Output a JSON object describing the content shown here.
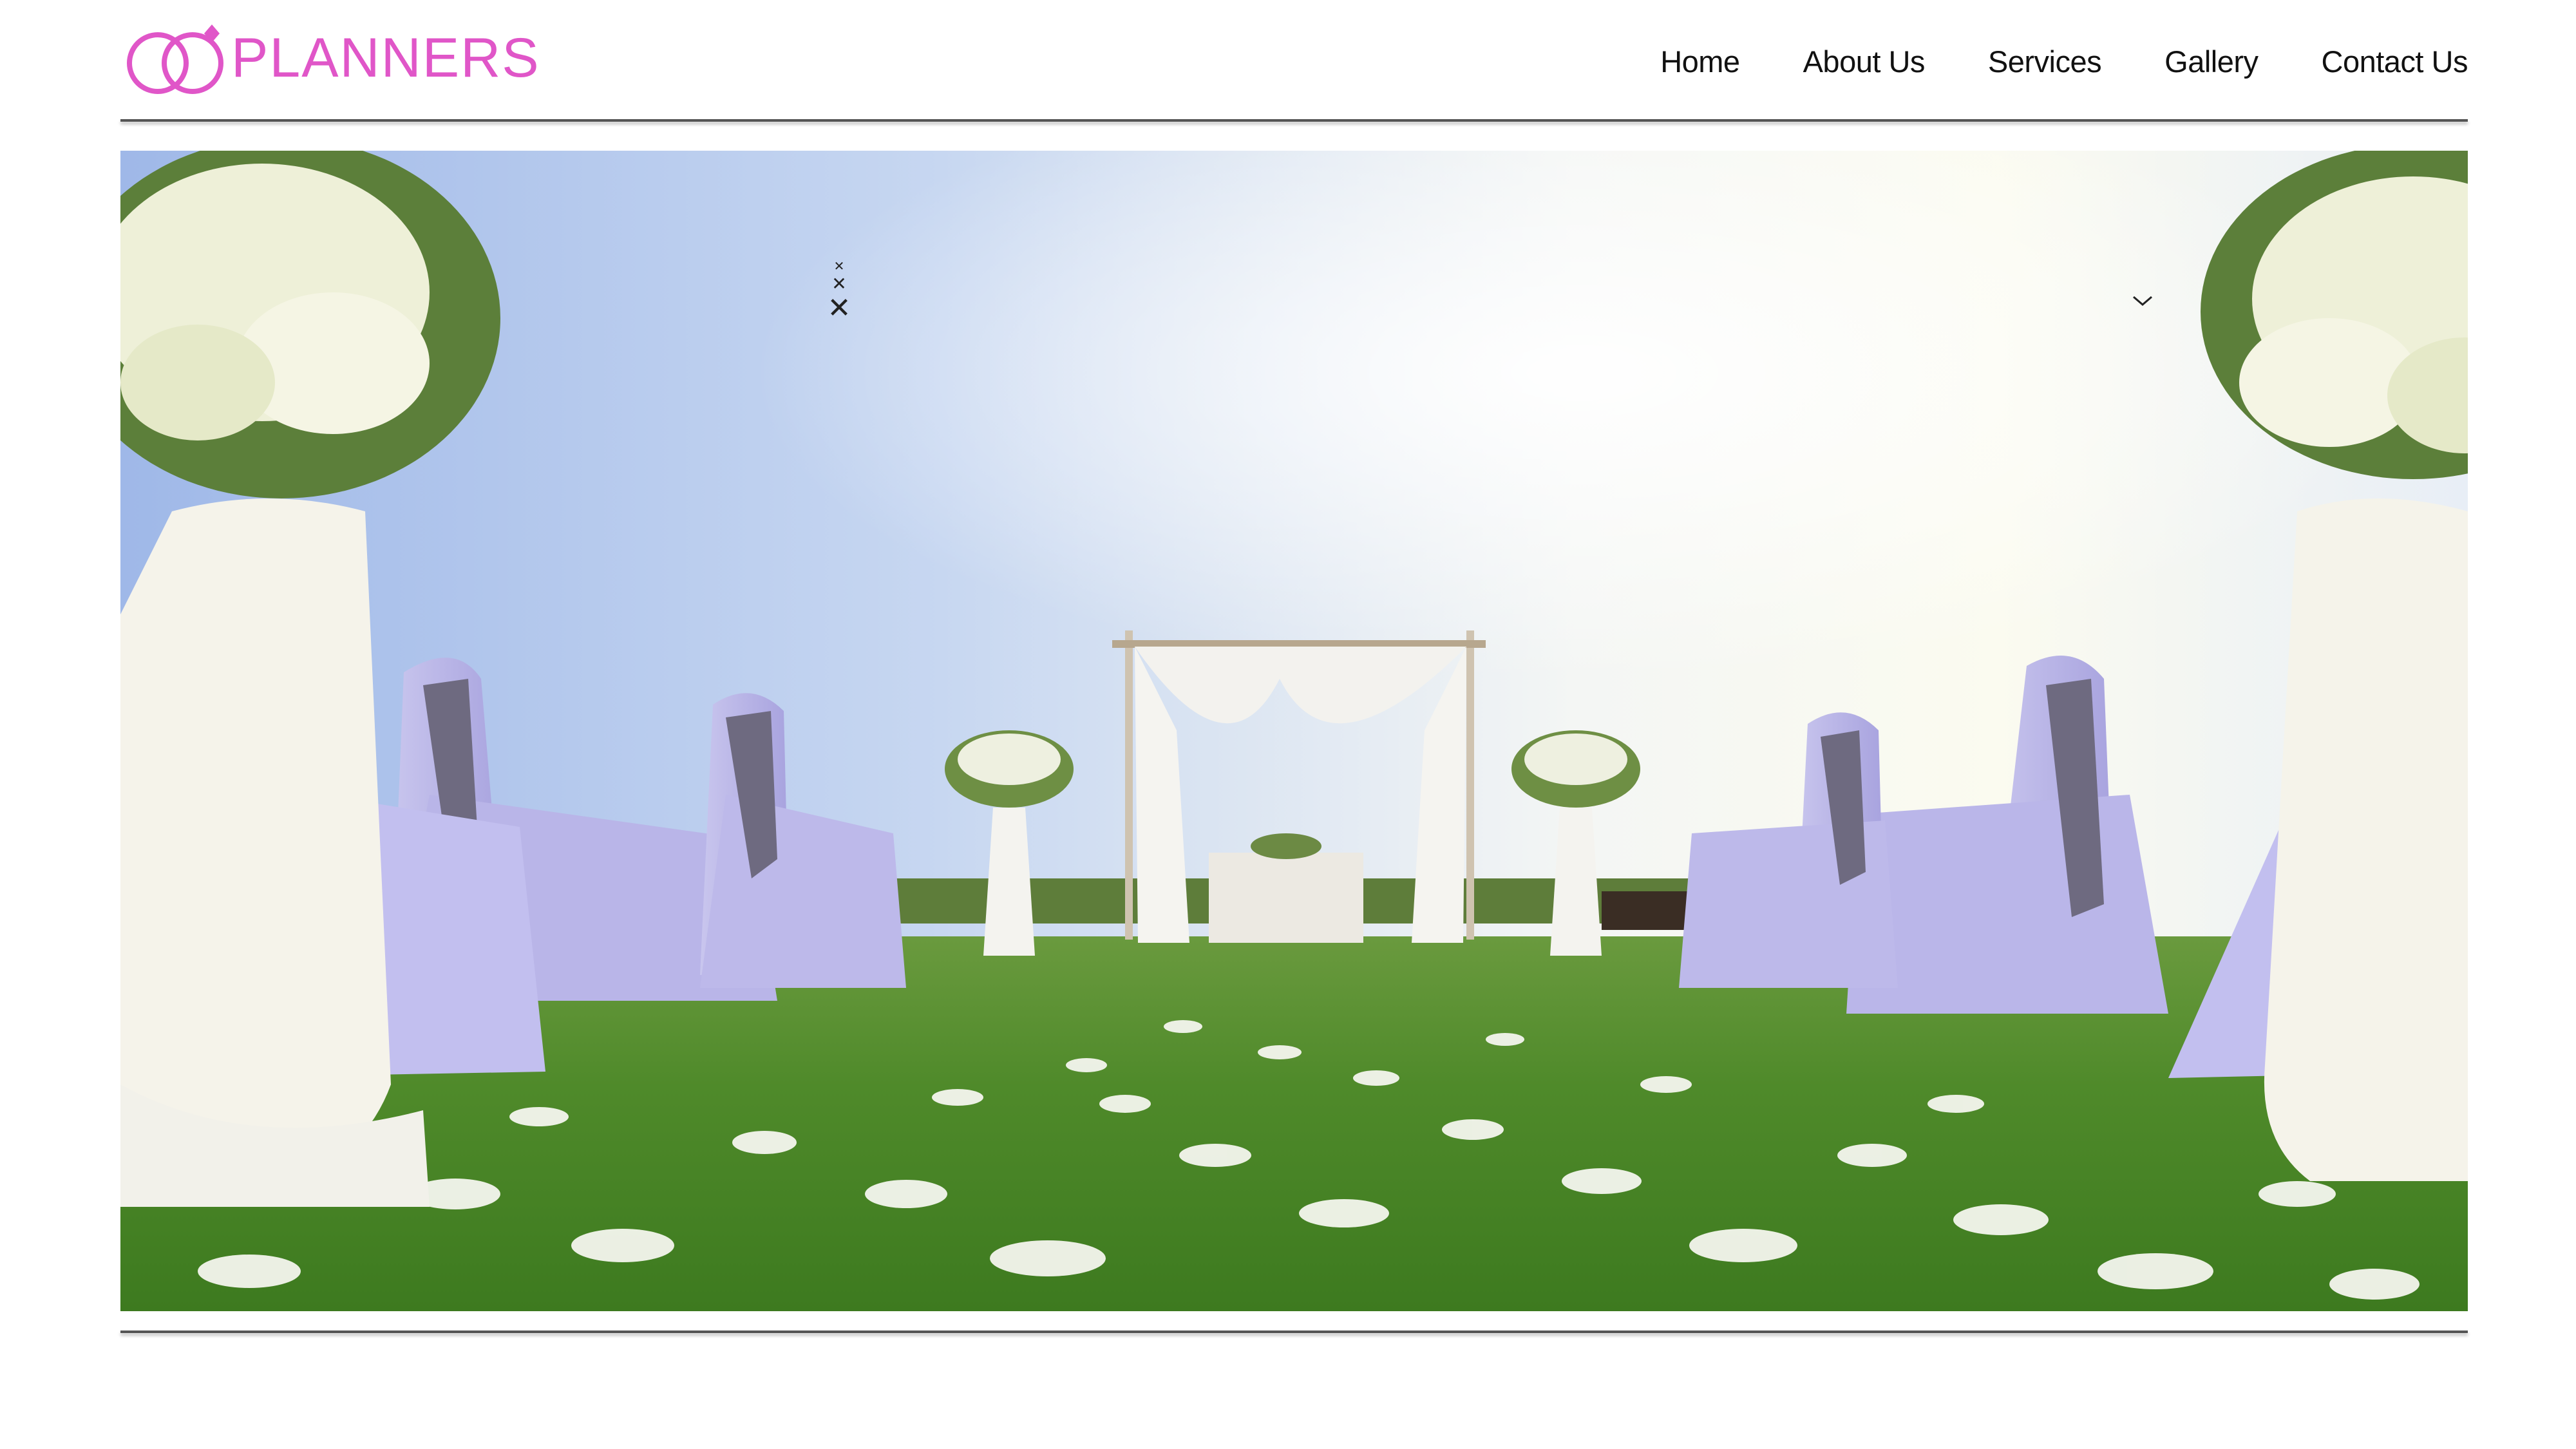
{
  "brand": {
    "name": "PLANNERS",
    "color": "#e056c8"
  },
  "nav": {
    "items": [
      {
        "label": "Home"
      },
      {
        "label": "About Us"
      },
      {
        "label": "Services"
      },
      {
        "label": "Gallery"
      },
      {
        "label": "Contact Us"
      }
    ]
  },
  "hero": {
    "image": "wedding-ceremony-lawn-photo",
    "close_icons": [
      "close-icon",
      "close-icon",
      "close-icon"
    ],
    "chevron_icon": "chevron-down-icon"
  },
  "colors": {
    "text": "#111111",
    "divider": "#555555"
  }
}
